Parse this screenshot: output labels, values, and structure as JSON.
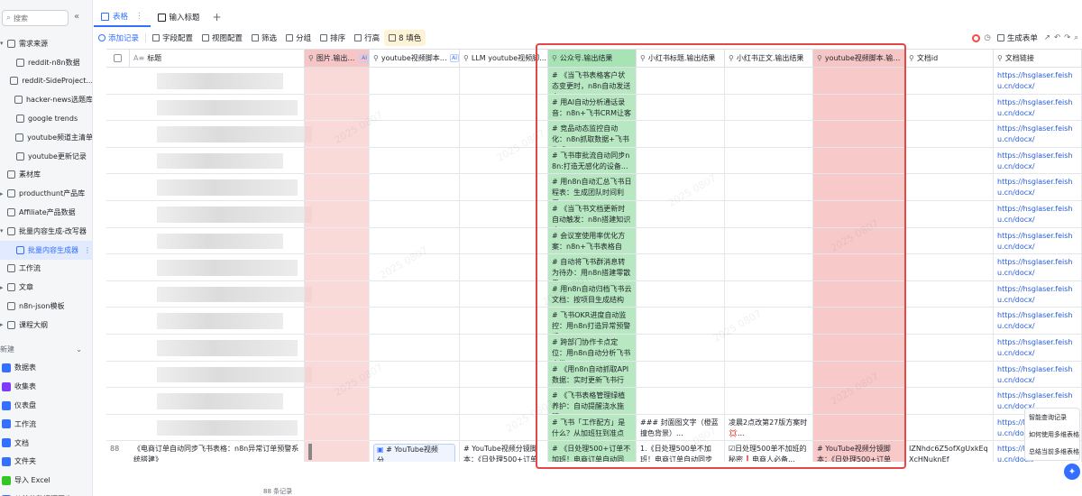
{
  "sidebar": {
    "search_placeholder": "搜索",
    "collapse_icon": "«",
    "items": [
      {
        "label": "需求来源",
        "level": 0,
        "kind": "folder",
        "expanded": true
      },
      {
        "label": "reddit-n8n数据",
        "level": 1,
        "kind": "table"
      },
      {
        "label": "reddit-SideProject...",
        "level": 1,
        "kind": "table"
      },
      {
        "label": "hacker-news选题库",
        "level": 1,
        "kind": "table"
      },
      {
        "label": "google trends",
        "level": 1,
        "kind": "table"
      },
      {
        "label": "youtube频道主清单",
        "level": 1,
        "kind": "table"
      },
      {
        "label": "youtube更新记录",
        "level": 1,
        "kind": "table"
      },
      {
        "label": "素材库",
        "level": 0,
        "kind": "table"
      },
      {
        "label": "producthunt产品库",
        "level": 0,
        "kind": "folder"
      },
      {
        "label": "Affiliate产品数据",
        "level": 0,
        "kind": "table"
      },
      {
        "label": "批量内容生成-改写器",
        "level": 0,
        "kind": "folder",
        "expanded": true
      },
      {
        "label": "批量内容生成器",
        "level": 1,
        "kind": "table",
        "active": true
      },
      {
        "label": "工作流",
        "level": 0,
        "kind": "workflow"
      },
      {
        "label": "文章",
        "level": 0,
        "kind": "folder"
      },
      {
        "label": "n8n-json模板",
        "level": 0,
        "kind": "table"
      },
      {
        "label": "课程大纲",
        "level": 0,
        "kind": "folder"
      }
    ],
    "new_header": "新建",
    "new_items": [
      {
        "label": "数据表",
        "color": "#3370ff"
      },
      {
        "label": "收集表",
        "color": "#7f3bf5"
      },
      {
        "label": "仪表盘",
        "color": "#3370ff"
      },
      {
        "label": "工作流",
        "color": "#3370ff"
      },
      {
        "label": "文档",
        "color": "#3370ff"
      },
      {
        "label": "文件夹",
        "color": "#3370ff"
      },
      {
        "label": "导入 Excel",
        "color": "#34c724"
      },
      {
        "label": "从其他数据源同步",
        "color": "#3370ff"
      }
    ]
  },
  "tabs": {
    "items": [
      {
        "label": "表格",
        "active": true
      },
      {
        "label": "输入标题",
        "active": false
      }
    ],
    "add": "+"
  },
  "toolbar": {
    "add_record": "添加记录",
    "field_config": "字段配置",
    "view_config": "视图配置",
    "filter": "筛选",
    "group": "分组",
    "sort": "排序",
    "row_height": "行高",
    "fill": "8 填色",
    "generate_form": "生成表单"
  },
  "columns": [
    {
      "id": "title",
      "label": "标题",
      "ai": false,
      "prefix": "A≡"
    },
    {
      "id": "image",
      "label": "图片.输出结...",
      "ai": true,
      "style": "pink"
    },
    {
      "id": "yt_script_p",
      "label": "youtube视频脚本p...",
      "ai": true
    },
    {
      "id": "llm_yt",
      "label": "LLM youtube视频脚本...",
      "ai": false
    },
    {
      "id": "wechat",
      "label": "公众号.输出结果",
      "ai": false,
      "style": "green"
    },
    {
      "id": "xhs_title",
      "label": "小红书标题.输出结果",
      "ai": false
    },
    {
      "id": "xhs_body",
      "label": "小红书正文.输出结果",
      "ai": false
    },
    {
      "id": "yt_script",
      "label": "youtube视频脚本.输出...",
      "ai": false,
      "style": "pink"
    },
    {
      "id": "doc_id",
      "label": "文档id",
      "ai": false
    },
    {
      "id": "doc_link",
      "label": "文档链接",
      "ai": false
    }
  ],
  "rows": [
    {
      "wechat": "# 《当飞书表格客户状态变更时，n8n自动发送定...",
      "link": "https://hsglaser.feishu.cn/docx/"
    },
    {
      "wechat": "# 用AI自动分析通话录音：n8n+飞书CRM让客户...",
      "link": "https://hsglaser.feishu.cn/docx/"
    },
    {
      "wechat": "# 竞品动态监控自动化：n8n抓取数据+飞书生成...",
      "link": "https://hsglaser.feishu.cn/docx/"
    },
    {
      "wechat": "# 飞书审批流自动同步n8n:打造无感化的设备...",
      "link": "https://hsglaser.feishu.cn/docx/"
    },
    {
      "wechat": "# 用n8n自动汇总飞书日程表：生成团队时间利用...",
      "link": "https://hsglaser.feishu.cn/docx/"
    },
    {
      "wechat": "# 《当飞书文档更新时自动触发：n8n搭建知识库...",
      "link": "https://hsglaser.feishu.cn/docx/"
    },
    {
      "wechat": "# 会议室使用率优化方案：n8n+飞书表格自动...",
      "link": "https://hsglaser.feishu.cn/docx/"
    },
    {
      "wechat": "# 自动将飞书群消息转为待办：用n8n搭建零散需...",
      "link": "https://hsglaser.feishu.cn/docx/"
    },
    {
      "wechat": "# 用n8n自动归档飞书云文档：按项目生成结构化...",
      "link": "https://hsglaser.feishu.cn/docx/"
    },
    {
      "wechat": "# 飞书OKR进度自动监控：用n8n打造异常预警系...",
      "link": "https://hsglaser.feishu.cn/docx/"
    },
    {
      "wechat": "# 跨部门协作卡点定位：用n8n自动分析飞书审批...",
      "link": "https://hsglaser.feishu.cn/docx/"
    },
    {
      "wechat": "# 《用n8n自动抓取API数据：实时更新飞书行业...",
      "link": "https://hsglaser.feishu.cn/docx/"
    },
    {
      "wechat": "# 《飞书表格管理绿植养护：自动提醒浇水施肥...",
      "link": "https://hsglaser.feishu.cn/docx/"
    },
    {
      "wechat": "# 飞书「工作配方」是什么？从加班狂到准点下...",
      "xhs_title": "### 封面图文字（橙蓝撞色背景）...",
      "xhs_body": "凌晨2点改第27版方案时💢...",
      "link": "https://hsglaser.feishu.cn/docx/"
    }
  ],
  "last_row": {
    "number": "88",
    "title": "《电商订单自动同步飞书表格：n8n异常订单预警系统搭建》",
    "yt_script_p": "# YouTube视频分...",
    "llm_yt": "# YouTube视频分镜脚本：《日处理500+订单不...",
    "wechat": "# 《日处理500+订单不加班！电商订单自动同步...",
    "xhs_title": "1.《日处理500单不加班！电商订单自动同步飞...",
    "xhs_body": "☑日处理500单不加班的秘密❗电商人必备...",
    "yt_script": "# YouTube视频分镜脚本：《日处理500+订单不...",
    "doc_id": "IZNhdc6Z5ofXgUxkEqXcHNuknEf",
    "link": "https://hsglaser.feishu.cn/docx/"
  },
  "floating_panel": [
    "智能查询记录",
    "如何使用多维表格",
    "总结当前多维表格"
  ],
  "footer": "88 条记录",
  "watermark": "2025 0807",
  "colors": {
    "accent": "#3370ff",
    "green": "#b7e8c1",
    "pink": "#f8c9c9",
    "highlight": "#e54646",
    "link": "#245bdb"
  }
}
